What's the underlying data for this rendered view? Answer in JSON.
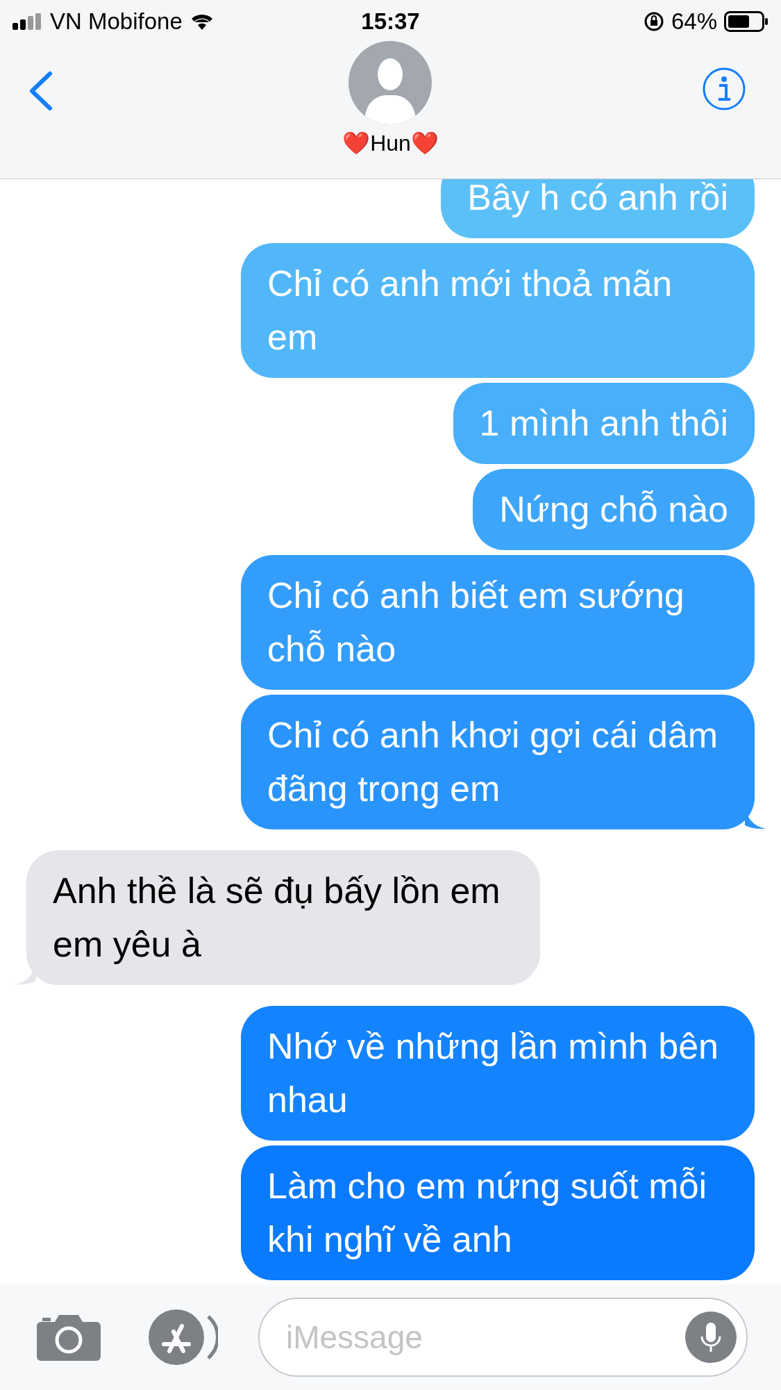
{
  "status_bar": {
    "carrier": "VN Mobifone",
    "time": "15:37",
    "battery": "64%"
  },
  "header": {
    "contact": "❤️Hun❤️"
  },
  "messages": [
    {
      "text": "Bây h có anh rồi",
      "kind": "outgoing",
      "tail": false
    },
    {
      "text": "Chỉ có anh mới thoả mãn em",
      "kind": "outgoing",
      "tail": false
    },
    {
      "text": "1 mình anh thôi",
      "kind": "outgoing",
      "tail": false
    },
    {
      "text": "Nứng chỗ nào",
      "kind": "outgoing",
      "tail": false
    },
    {
      "text": "Chỉ có anh biết em sướng chỗ nào",
      "kind": "outgoing",
      "tail": false
    },
    {
      "text": "Chỉ có anh khơi gợi cái dâm đãng trong em",
      "kind": "outgoing",
      "tail": true
    },
    {
      "text": "Anh thề là sẽ đụ bấy lồn em em yêu à",
      "kind": "incoming",
      "tail": true
    },
    {
      "text": "Nhớ về những lần mình bên nhau",
      "kind": "outgoing",
      "tail": false
    },
    {
      "text": "Làm cho em nứng suốt mỗi khi nghĩ về anh",
      "kind": "outgoing",
      "tail": false
    }
  ],
  "composer": {
    "placeholder": "iMessage"
  }
}
